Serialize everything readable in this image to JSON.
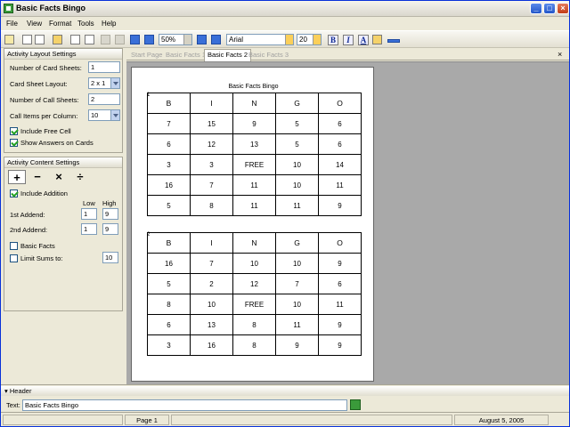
{
  "window": {
    "title": "Basic Facts Bingo"
  },
  "menu": [
    "File",
    "View",
    "Format",
    "Tools",
    "Help"
  ],
  "toolbar": {
    "zoom": "50%",
    "font": "Arial",
    "size": "20",
    "bold": "B",
    "italic": "I",
    "underline": "A"
  },
  "layout_settings": {
    "title": "Activity Layout Settings",
    "num_card_sheets_label": "Number of Card Sheets:",
    "num_card_sheets": "1",
    "card_sheet_layout_label": "Card Sheet Layout:",
    "card_sheet_layout": "2 x 1",
    "num_call_sheets_label": "Number of Call Sheets:",
    "num_call_sheets": "2",
    "call_items_label": "Call Items per Column:",
    "call_items": "10",
    "include_free_cell": "Include Free Cell",
    "show_answers": "Show Answers on Cards"
  },
  "content_settings": {
    "title": "Activity Content Settings",
    "ops": [
      "+",
      "−",
      "×",
      "÷"
    ],
    "include_addition": "Include Addition",
    "low_label": "Low",
    "high_label": "High",
    "first_addend_label": "1st Addend:",
    "first_low": "1",
    "first_high": "9",
    "second_addend_label": "2nd Addend:",
    "second_low": "1",
    "second_high": "9",
    "basic_facts": "Basic Facts",
    "limit_sums": "Limit Sums to:",
    "limit_value": "10"
  },
  "tabs": [
    "Start Page",
    "Basic Facts 1",
    "Basic Facts 2",
    "Basic Facts 3"
  ],
  "page": {
    "title": "Basic Facts Bingo",
    "cards": [
      {
        "number": "1",
        "header": [
          "B",
          "I",
          "N",
          "G",
          "O"
        ],
        "rows": [
          [
            "7",
            "15",
            "9",
            "5",
            "6"
          ],
          [
            "6",
            "12",
            "13",
            "5",
            "6"
          ],
          [
            "3",
            "3",
            "FREE",
            "10",
            "14"
          ],
          [
            "16",
            "7",
            "11",
            "10",
            "11"
          ],
          [
            "5",
            "8",
            "11",
            "11",
            "9"
          ]
        ]
      },
      {
        "number": "2",
        "header": [
          "B",
          "I",
          "N",
          "G",
          "O"
        ],
        "rows": [
          [
            "16",
            "7",
            "10",
            "10",
            "9"
          ],
          [
            "5",
            "2",
            "12",
            "7",
            "6"
          ],
          [
            "8",
            "10",
            "FREE",
            "10",
            "11"
          ],
          [
            "6",
            "13",
            "8",
            "11",
            "9"
          ],
          [
            "3",
            "16",
            "8",
            "9",
            "9"
          ]
        ]
      }
    ]
  },
  "header_panel": {
    "title": "Header",
    "text_label": "Text:",
    "text_value": "Basic Facts Bingo"
  },
  "status": {
    "page": "Page 1",
    "date": "August 5, 2005"
  }
}
